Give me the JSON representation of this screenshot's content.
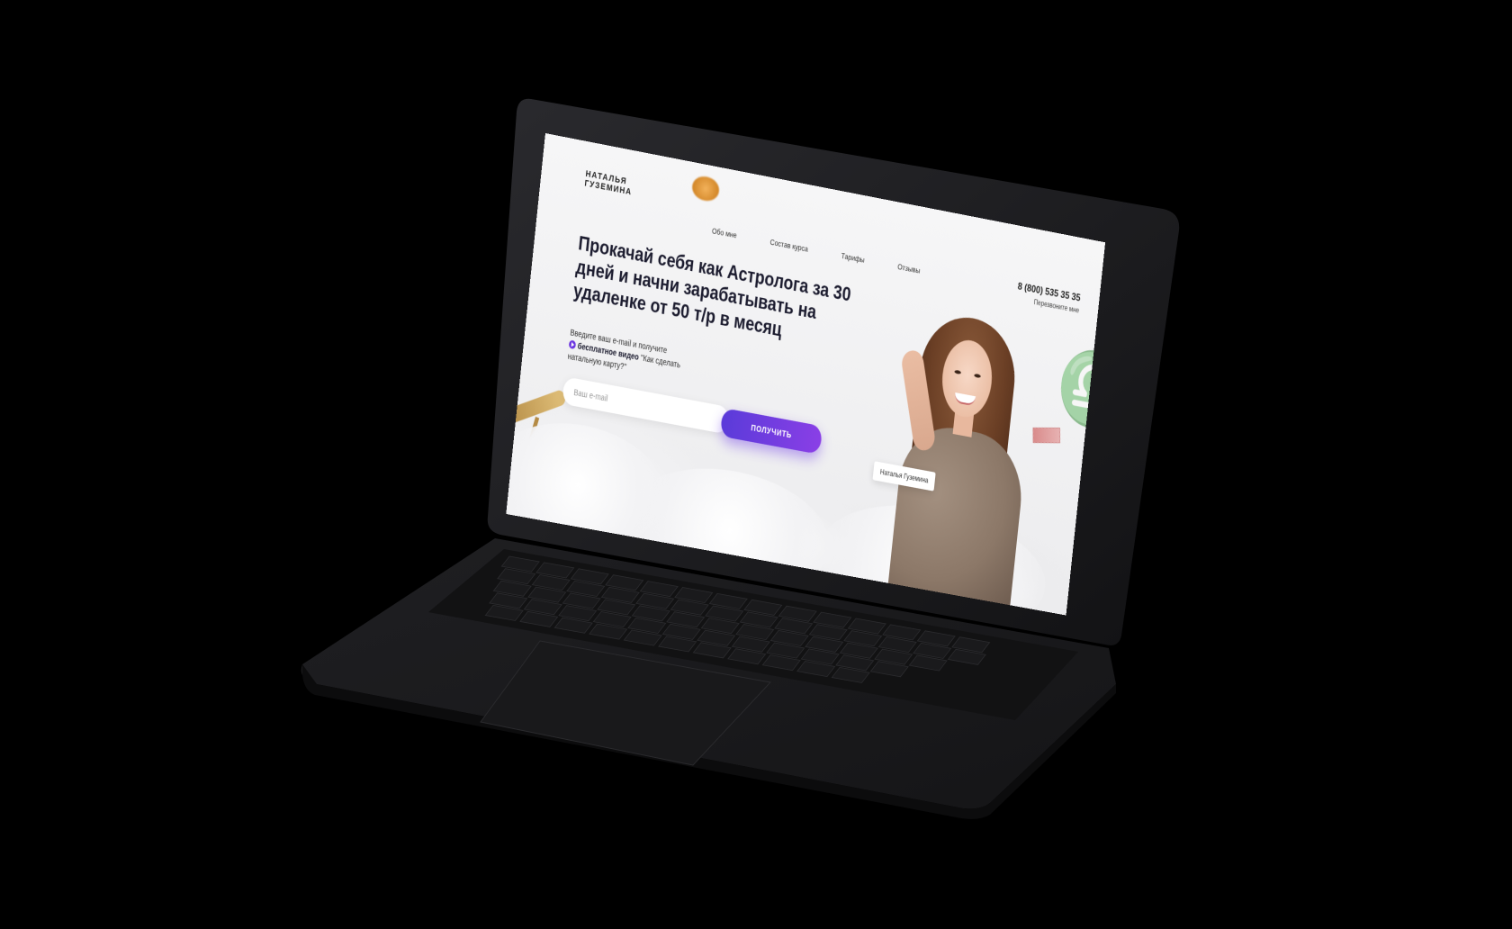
{
  "site": {
    "logo_line1": "НАТАЛЬЯ",
    "logo_line2": "ГУЗЕМИНА",
    "nav": [
      {
        "label": "Обо мне"
      },
      {
        "label": "Состав курса"
      },
      {
        "label": "Тарифы"
      },
      {
        "label": "Отзывы"
      }
    ],
    "phone": "8 (800) 535 35 35",
    "callback_label": "Перезвоните мне",
    "headline": "Прокачай себя как Астролога за 30 дней и начни зарабатывать на удаленке от 50 т/р в месяц",
    "intro_before": "Введите ваш e-mail и получите",
    "intro_bold": "бесплатное видео",
    "intro_after": "\"Как сделать натальную карту?\"",
    "email_placeholder": "Ваш e-mail",
    "email_value": "",
    "submit_label": "ПОЛУЧИТЬ",
    "name_tag": "Наталья Гуземина",
    "zodiac_glyph": "♎"
  },
  "colors": {
    "accent_start": "#5a3bd9",
    "accent_end": "#8a3fe6",
    "laptop_body": "#1c1c1f",
    "background": "#000000"
  }
}
